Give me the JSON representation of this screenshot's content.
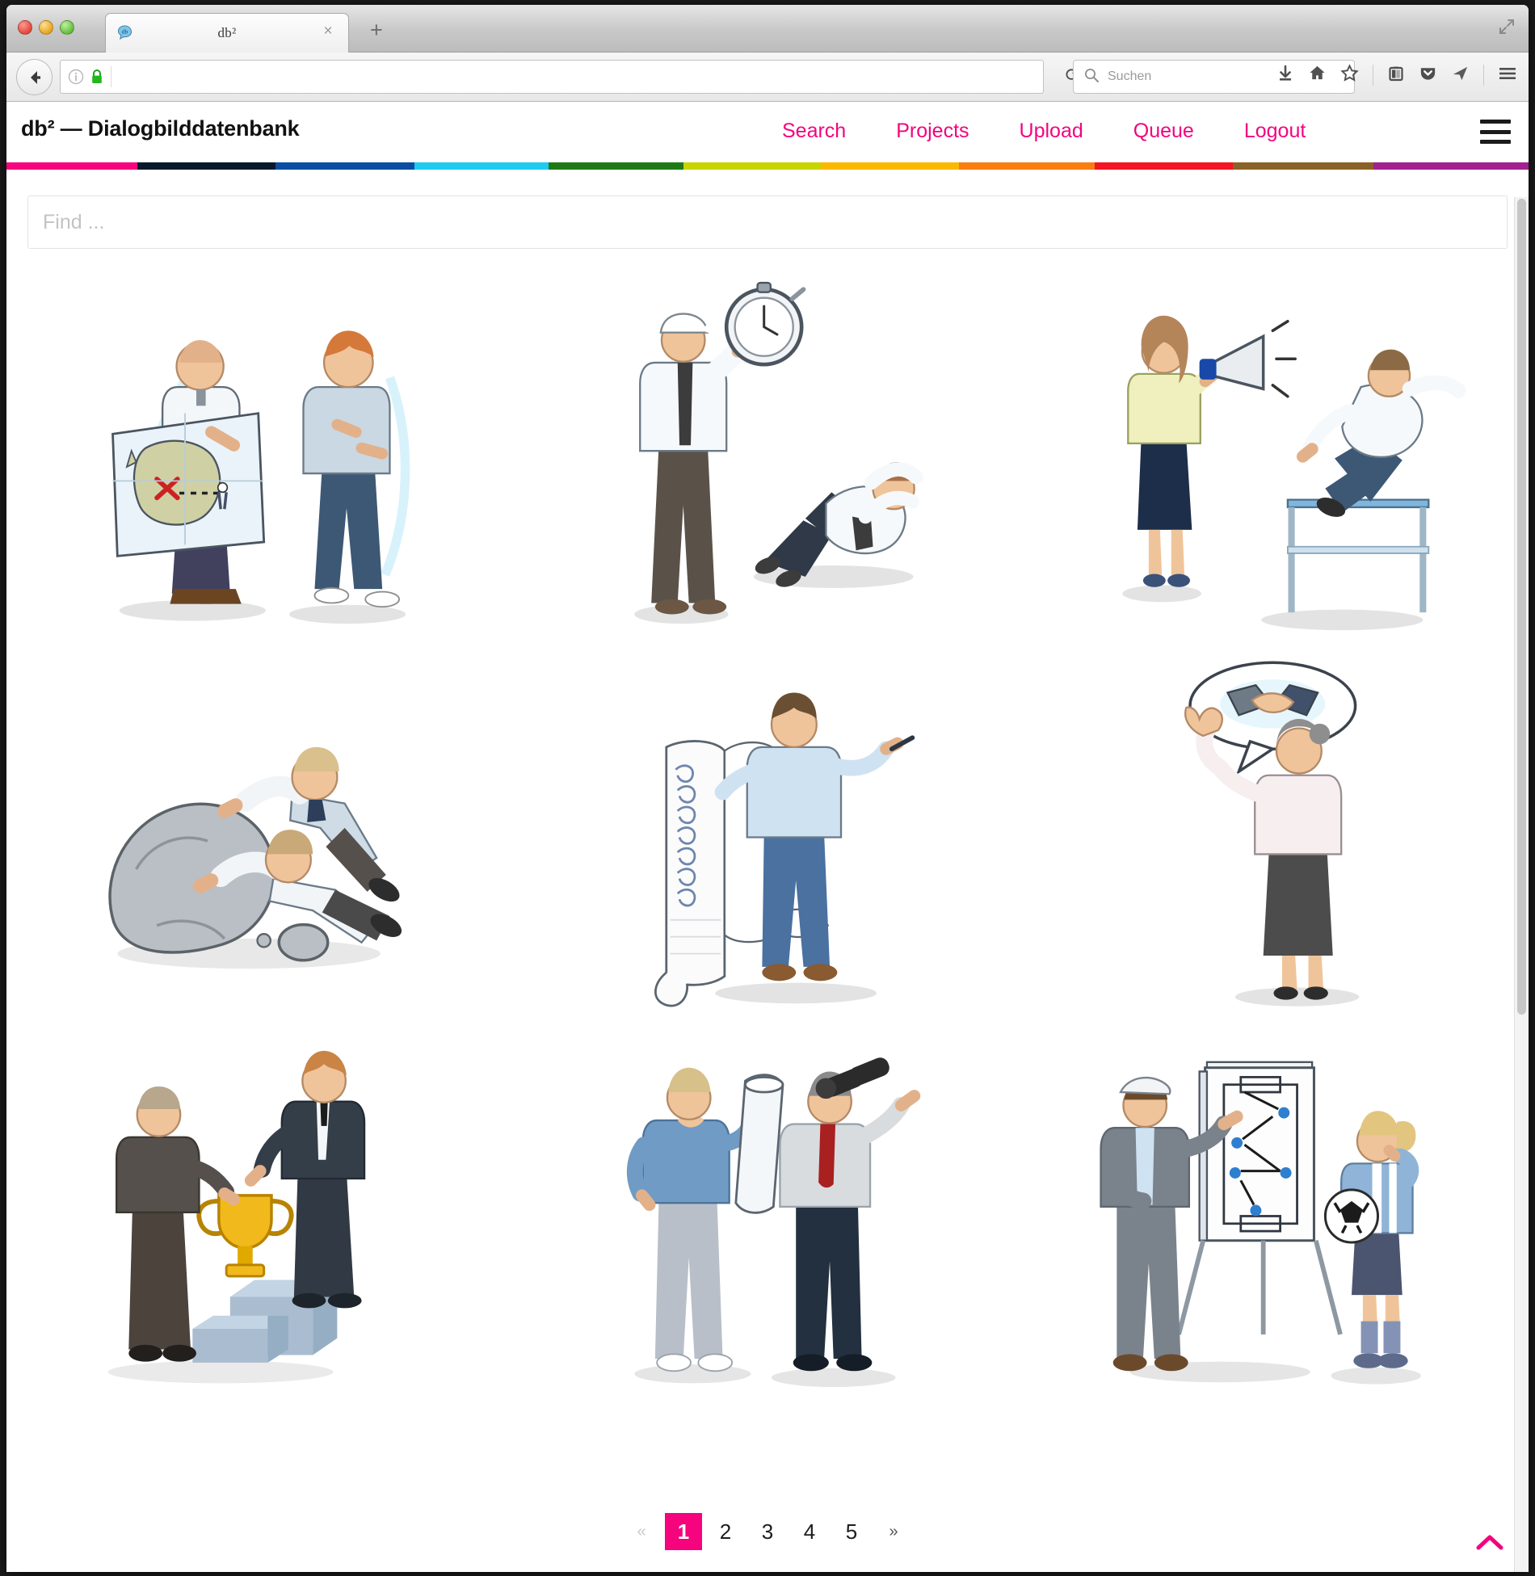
{
  "browser": {
    "window_controls": [
      "close",
      "minimize",
      "zoom"
    ],
    "tab": {
      "title": "db²",
      "favicon": "speech-bubble-favicon",
      "close_label": "×"
    },
    "new_tab_label": "+",
    "expand_icon": "fullscreen-expand-icon",
    "back_icon": "back-arrow-icon",
    "identity_icon": "info-circle-icon",
    "security_icon": "green-padlock-icon",
    "url_value": "",
    "reload_label": "⟳",
    "search_placeholder": "Suchen",
    "search_icon": "magnifier-icon",
    "toolbar_icons": [
      "download-arrow-icon",
      "home-icon",
      "bookmark-star-icon",
      "library-icon",
      "pocket-icon",
      "send-to-device-icon",
      "menu-hamburger-icon"
    ]
  },
  "app": {
    "brand": "db² — Dialogbilddatenbank",
    "nav": [
      {
        "label": "Search"
      },
      {
        "label": "Projects"
      },
      {
        "label": "Upload"
      },
      {
        "label": "Queue"
      },
      {
        "label": "Logout"
      }
    ],
    "menu_icon": "hamburger-menu-icon",
    "accent_color": "#f2047e",
    "color_bar": [
      {
        "color": "#f5047e",
        "width": 8.6
      },
      {
        "color": "#071a2c",
        "width": 9.1
      },
      {
        "color": "#0b4da2",
        "width": 9.1
      },
      {
        "color": "#1ecbf0",
        "width": 8.8
      },
      {
        "color": "#1f7a16",
        "width": 8.9
      },
      {
        "color": "#c8d400",
        "width": 9.0
      },
      {
        "color": "#fcb800",
        "width": 9.1
      },
      {
        "color": "#f97d10",
        "width": 8.9
      },
      {
        "color": "#f41423",
        "width": 9.1
      },
      {
        "color": "#8a6228",
        "width": 9.2
      },
      {
        "color": "#a1218f",
        "width": 10.2
      }
    ]
  },
  "search": {
    "placeholder": "Find ...",
    "value": ""
  },
  "gallery": {
    "items": [
      {
        "id": 1,
        "alt": "Two men with a treasure map marked with a red X"
      },
      {
        "id": 2,
        "alt": "Man with cap holding a large stopwatch beside a man relaxing on the floor"
      },
      {
        "id": 3,
        "alt": "Woman with a megaphone and man jumping over a hurdle"
      },
      {
        "id": 4,
        "alt": "Two men pushing a large boulder"
      },
      {
        "id": 5,
        "alt": "Man holding a long paper scroll pointing a pen"
      },
      {
        "id": 6,
        "alt": "Woman in white blouse raising a hand to stop, handshake thought bubble"
      },
      {
        "id": 7,
        "alt": "Man handing a golden trophy to a man on a podium"
      },
      {
        "id": 8,
        "alt": "Man with rolled blueprint and man looking through binoculars"
      },
      {
        "id": 9,
        "alt": "Coach at a flipchart with tactics and a female soccer player holding a ball"
      }
    ]
  },
  "pagination": {
    "prev_label": "«",
    "next_label": "»",
    "pages": [
      "1",
      "2",
      "3",
      "4",
      "5"
    ],
    "current": "1"
  },
  "scroll_top": {
    "icon": "chevron-up-icon"
  }
}
